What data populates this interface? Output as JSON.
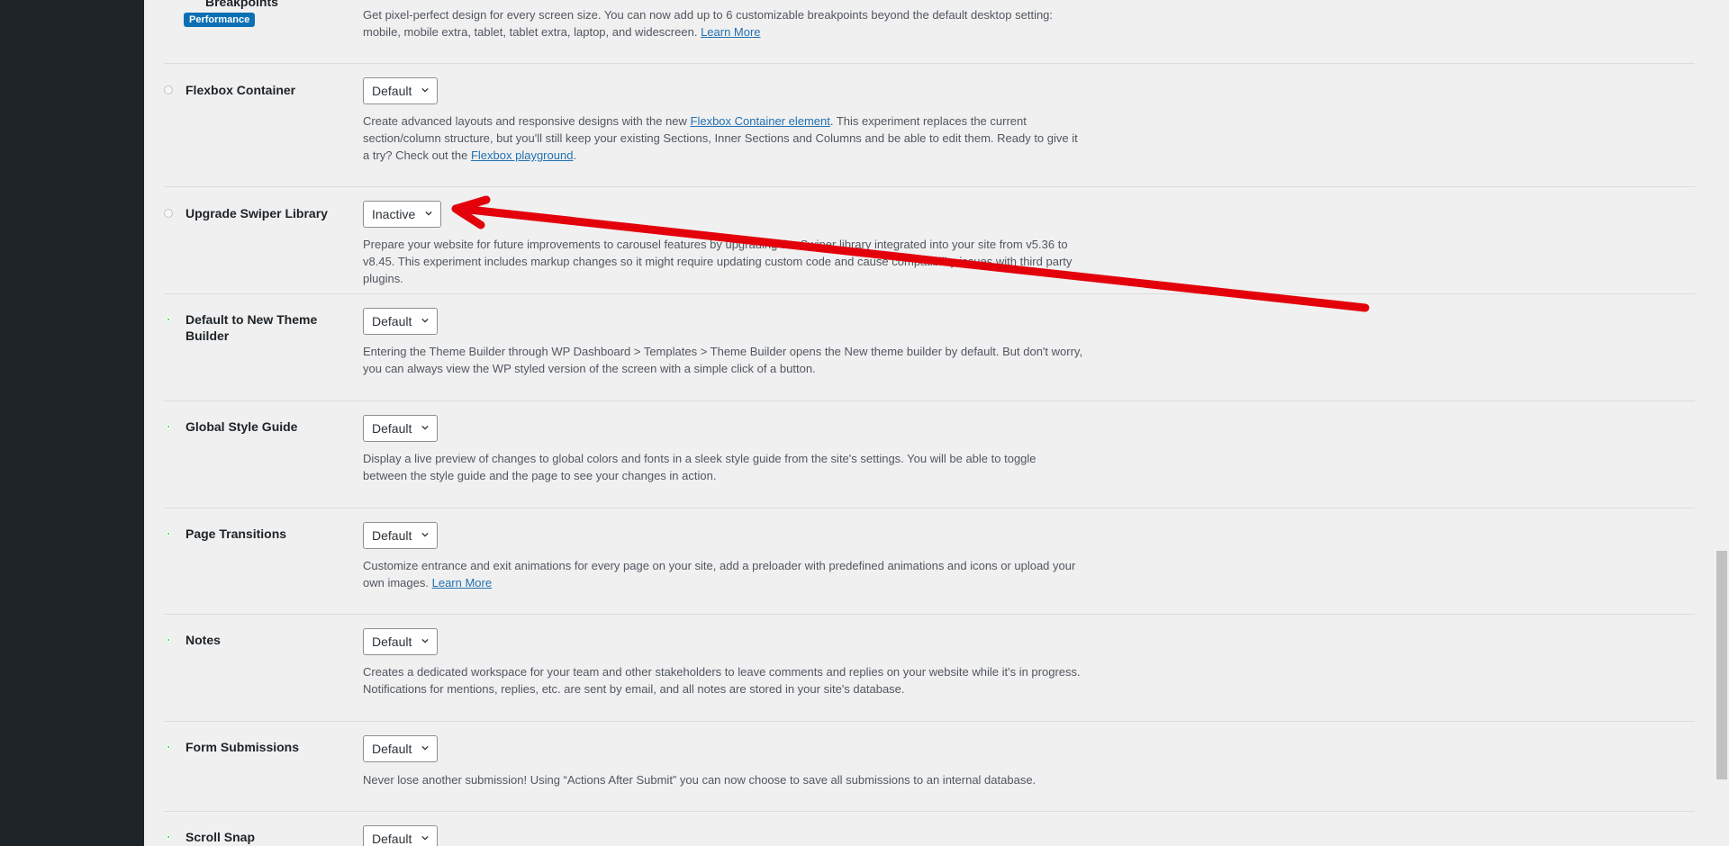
{
  "colors": {
    "active_dot": "#39b54a",
    "link": "#2271b1",
    "badge": "#0c70b4",
    "annotation_arrow": "#e3000b",
    "sidebar": "#1d2327"
  },
  "top_partial": {
    "title": "Breakpoints",
    "badge": "Performance",
    "desc_text": "Get pixel-perfect design for every screen size. You can now add up to 6 customizable breakpoints beyond the default desktop setting: mobile, mobile extra, tablet, tablet extra, laptop, and widescreen.",
    "desc_link": "Learn More"
  },
  "experiments": [
    {
      "name": "Flexbox Container",
      "status": "inactive",
      "select": "Default",
      "desc_a": "Create advanced layouts and responsive designs with the new",
      "link1": "Flexbox Container element",
      "desc_b": ". This experiment replaces the current section/column structure, but you'll still keep your existing Sections, Inner Sections and Columns and be able to edit them. Ready to give it a try? Check out the",
      "link2": "Flexbox playground",
      "desc_c": "."
    },
    {
      "name": "Upgrade Swiper Library",
      "status": "inactive",
      "select": "Inactive",
      "desc_a": "Prepare your website for future improvements to carousel features by upgrading the Swiper library integrated into your site from v5.36 to v8.45. This experiment includes markup changes so it might require updating custom code and cause compatibility issues with third party plugins."
    },
    {
      "name": "Default to New Theme Builder",
      "status": "active",
      "select": "Default",
      "desc_a": "Entering the Theme Builder through WP Dashboard > Templates > Theme Builder opens the New theme builder by default. But don't worry, you can always view the WP styled version of the screen with a simple click of a button."
    },
    {
      "name": "Global Style Guide",
      "status": "active",
      "select": "Default",
      "desc_a": "Display a live preview of changes to global colors and fonts in a sleek style guide from the site's settings. You will be able to toggle between the style guide and the page to see your changes in action."
    },
    {
      "name": "Page Transitions",
      "status": "active",
      "select": "Default",
      "desc_a": "Customize entrance and exit animations for every page on your site, add a preloader with predefined animations and icons or upload your own images.",
      "link1": "Learn More"
    },
    {
      "name": "Notes",
      "status": "active",
      "select": "Default",
      "desc_a": "Creates a dedicated workspace for your team and other stakeholders to leave comments and replies on your website while it's in progress. Notifications for mentions, replies, etc. are sent by email, and all notes are stored in your site's database."
    },
    {
      "name": "Form Submissions",
      "status": "active",
      "select": "Default",
      "desc_a": "Never lose another submission! Using “Actions After Submit” you can now choose to save all submissions to an internal database."
    },
    {
      "name": "Scroll Snap",
      "status": "active",
      "select": "Default"
    }
  ]
}
